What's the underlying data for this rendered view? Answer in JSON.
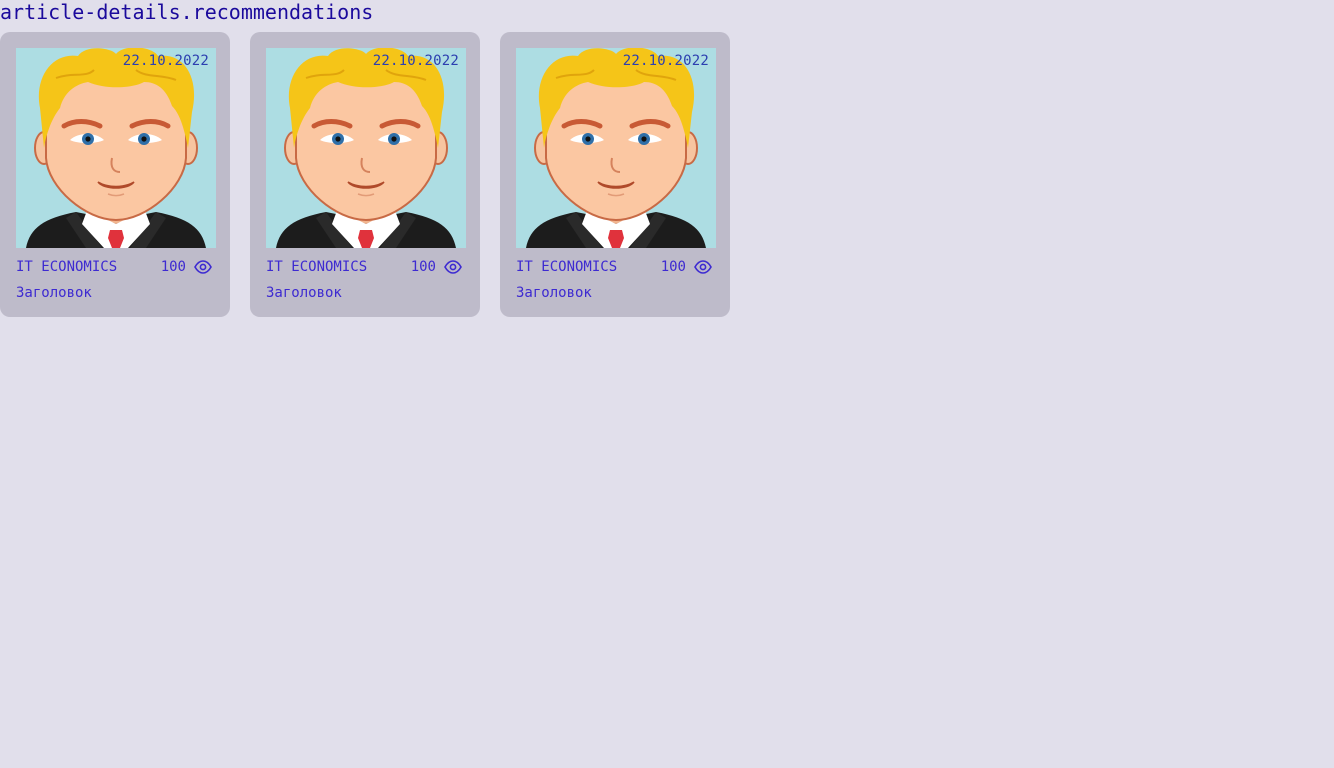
{
  "page": {
    "title": "article-details.recommendations"
  },
  "colors": {
    "background": "#e1dfeb",
    "card_background": "#bebbca",
    "text_primary": "#1b0a9c",
    "text_card": "#3d2ad1",
    "image_background": "#addde3"
  },
  "recommendations": [
    {
      "date": "22.10.2022",
      "type": "IT ECONOMICS",
      "views": "100",
      "title": "Заголовок",
      "views_icon": "eye-icon",
      "image": "cartoon-businessman-avatar"
    },
    {
      "date": "22.10.2022",
      "type": "IT ECONOMICS",
      "views": "100",
      "title": "Заголовок",
      "views_icon": "eye-icon",
      "image": "cartoon-businessman-avatar"
    },
    {
      "date": "22.10.2022",
      "type": "IT ECONOMICS",
      "views": "100",
      "title": "Заголовок",
      "views_icon": "eye-icon",
      "image": "cartoon-businessman-avatar"
    }
  ]
}
